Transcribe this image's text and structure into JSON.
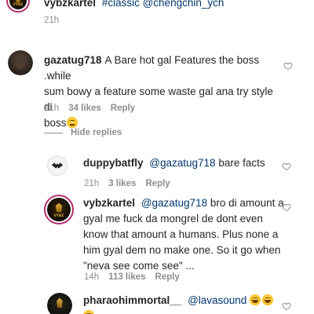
{
  "top_comment": {
    "username": "vybzkartel",
    "text_prefix": "#classic",
    "mention": "@chengchin_ych",
    "time": "21h"
  },
  "comment_gaza": {
    "username": "gazatug718",
    "text_line1": "A Bare hot gal Features the boss .while",
    "text_line2": "sum bowy a feature some waste gal ana try style di",
    "text_line3": "boss",
    "emoji": "thinking-face",
    "time": "21h",
    "likes": "34 likes",
    "reply": "Reply"
  },
  "hide_replies": {
    "label": "Hide replies"
  },
  "reply_duppy": {
    "username": "duppybatfly",
    "mention": "@gazatug718",
    "text": "bare facts",
    "time": "21h",
    "likes": "3 likes",
    "reply": "Reply"
  },
  "reply_vybz": {
    "username": "vybzkartel",
    "mention": "@gazatug718",
    "text_line1": "bro di amount a",
    "text_line2": "gyal me fuck da mongrel de dont even",
    "text_line3": "know that amount a humans. Plus none a",
    "text_line4": "him gyal dem no make one. So it go when",
    "text_line5": "\"neva see come see\" ...",
    "time": "14h",
    "likes": "113 likes",
    "reply": "Reply"
  },
  "reply_pharaoh": {
    "username": "pharaohimmortal__",
    "mention": "@lavasound",
    "emoji": "grinning-sweat-face"
  },
  "colors": {
    "text": "#262626",
    "muted": "#8e8e8e",
    "mention": "#00376b",
    "story_ring": "#b52f6d"
  }
}
